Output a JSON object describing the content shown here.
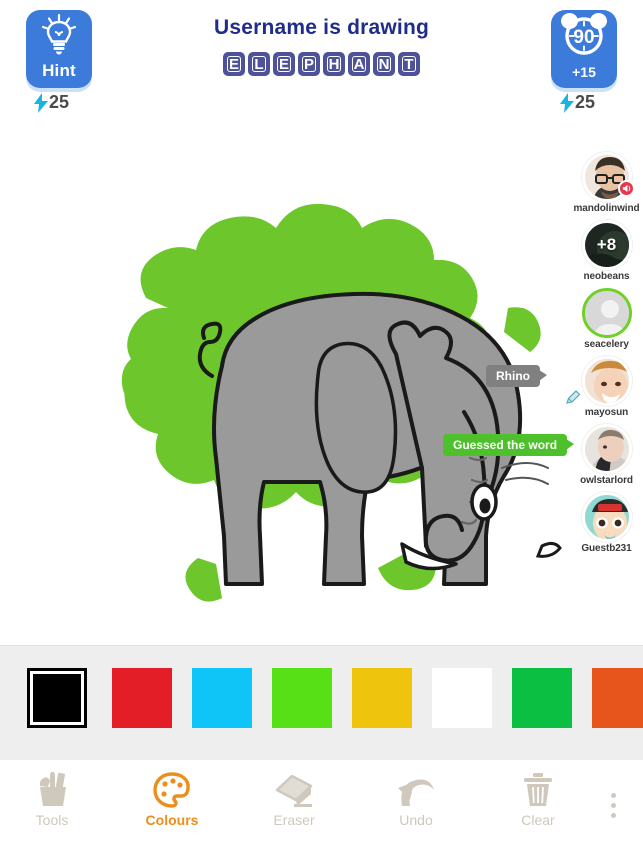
{
  "header": {
    "title": "Username is drawing",
    "word_letters": [
      "E",
      "L",
      "E",
      "P",
      "H",
      "A",
      "N",
      "T"
    ],
    "word": "ELEPHANT",
    "title_color": "#1f2c8c",
    "tile_color": "#4e5298",
    "hint_button": {
      "label": "Hint",
      "icon": "lightbulb-icon",
      "cost": "25",
      "color": "#3d7bdb"
    },
    "timer_button": {
      "label": "90",
      "bonus_label": "+15",
      "icon": "alarm-clock-icon",
      "cost": "25",
      "color": "#3d7bdb"
    }
  },
  "canvas": {
    "background_color": "#ffffff",
    "brush_color": "#6cc62c",
    "subject": "elephant",
    "body_color": "#9a9a9a",
    "outline_color": "#1a1a1a"
  },
  "chat_bubbles": [
    {
      "text": "Rhino",
      "type": "guess",
      "color": "#808080"
    },
    {
      "text": "Guessed the word",
      "type": "correct",
      "color": "#4ec02b"
    }
  ],
  "players": [
    {
      "name": "mandolinwind",
      "badge": "muted-icon",
      "badge_color": "#e8374a",
      "score": "",
      "active": false
    },
    {
      "name": "neobeans",
      "badge": "",
      "score": "+8",
      "active": false
    },
    {
      "name": "seacelery",
      "badge": "",
      "score": "",
      "active": true,
      "active_color": "#6fd02b"
    },
    {
      "name": "mayosun",
      "badge": "pencil-icon",
      "score": "",
      "active": false
    },
    {
      "name": "owlstarlord",
      "badge": "",
      "score": "",
      "active": false
    },
    {
      "name": "Guestb231",
      "badge": "",
      "score": "",
      "active": false
    }
  ],
  "palette": {
    "selected_index": 0,
    "swatches": [
      {
        "name": "black",
        "hex": "#000000"
      },
      {
        "name": "red",
        "hex": "#e41e26"
      },
      {
        "name": "cyan",
        "hex": "#0fc4f7"
      },
      {
        "name": "green",
        "hex": "#58e016"
      },
      {
        "name": "yellow",
        "hex": "#efc40c"
      },
      {
        "name": "white",
        "hex": "#ffffff"
      },
      {
        "name": "emerald",
        "hex": "#0abf41"
      },
      {
        "name": "orange",
        "hex": "#e8551c"
      }
    ]
  },
  "toolbar": {
    "active_tool": "Colours",
    "active_color": "#ec8e1c",
    "inactive_color": "#cfc8bd",
    "items": [
      {
        "label": "Tools",
        "icon": "pencil-cup-icon"
      },
      {
        "label": "Colours",
        "icon": "palette-icon"
      },
      {
        "label": "Eraser",
        "icon": "eraser-icon"
      },
      {
        "label": "Undo",
        "icon": "undo-arrow-icon"
      },
      {
        "label": "Clear",
        "icon": "trash-can-icon"
      }
    ],
    "more_label": "more-options"
  }
}
